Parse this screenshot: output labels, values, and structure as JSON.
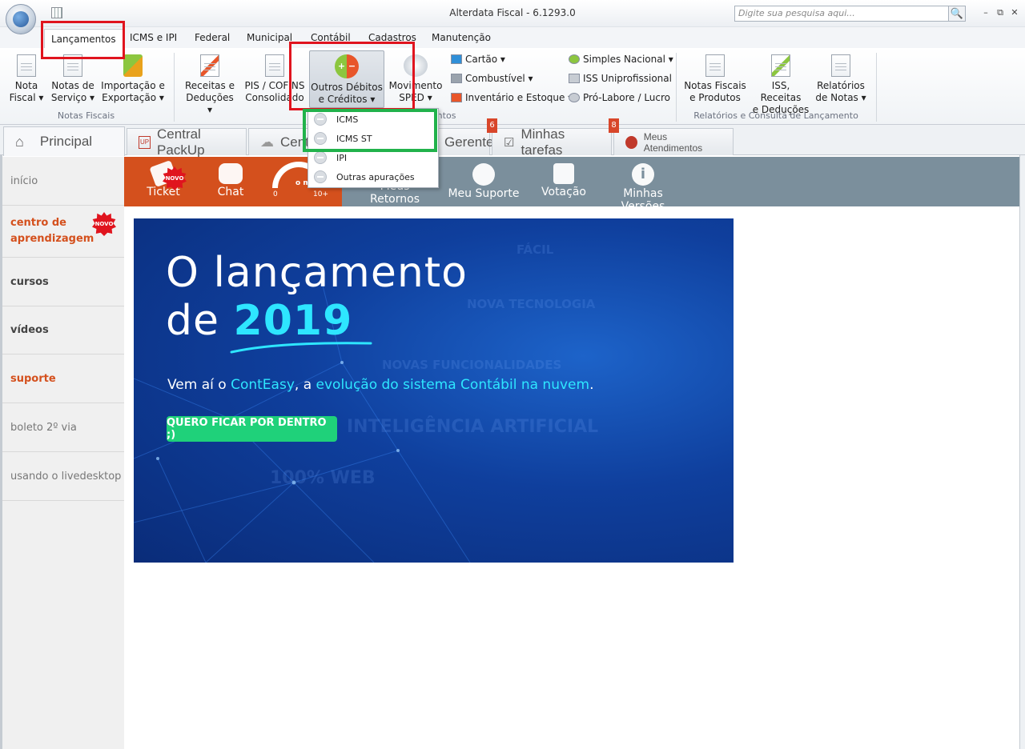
{
  "window": {
    "title": "Alterdata Fiscal - 6.1293.0",
    "search_placeholder": "Digite sua pesquisa aqui..."
  },
  "menu_tabs": [
    "Lançamentos",
    "ICMS e IPI",
    "Federal",
    "Municipal",
    "Contábil",
    "Cadastros",
    "Manutenção"
  ],
  "ribbon": {
    "nota_fiscal": [
      "Nota",
      "Fiscal ▾"
    ],
    "notas_servico": [
      "Notas de",
      "Serviço ▾"
    ],
    "importacao": [
      "Importação e",
      "Exportação ▾"
    ],
    "group_notas_fiscais": "Notas Fiscais",
    "receitas": [
      "Receitas e",
      "Deduções ▾"
    ],
    "pis_cofins": [
      "PIS / COFINS",
      "Consolidado"
    ],
    "outros_debitos": [
      "Outros Débitos",
      "e Créditos ▾"
    ],
    "movimento": [
      "Movimento",
      "SPED ▾"
    ],
    "group_lancamentos": "Lançamentos",
    "cartao": "Cartão ▾",
    "combustivel": "Combustível ▾",
    "inventario": "Inventário e Estoque ▾",
    "simples": "Simples Nacional ▾",
    "iss_uni": "ISS Uniprofissional",
    "prolabore": "Pró-Labore / Lucro",
    "notas_produtos": [
      "Notas Fiscais",
      "e Produtos"
    ],
    "iss_receitas": [
      "ISS, Receitas",
      "e Deduções"
    ],
    "relatorios": [
      "Relatórios",
      "de Notas ▾"
    ],
    "group_relatorios": "Relatórios e Consulta de Lançamento"
  },
  "dropdown": [
    "ICMS",
    "ICMS ST",
    "IPI",
    "Outras apurações"
  ],
  "tabs": {
    "principal": "Principal",
    "packup": "Central PackUp",
    "central": "Central",
    "gerente": "Gerente",
    "tarefas": "Minhas tarefas",
    "atendimentos": "Meus Atendimentos",
    "badge1": "6",
    "badge2": "8"
  },
  "sidebar": [
    "início",
    "centro de aprendizagem",
    "cursos",
    "vídeos",
    "suporte",
    "boleto 2º via",
    "usando o livedesktop"
  ],
  "novo": "NOVO",
  "toolbar": {
    "ticket": "Ticket",
    "chat": "Chat",
    "gauge_min": "0",
    "gauge_max": "10+",
    "gauge_mid": "o min",
    "retornos": "Meus Retornos",
    "suporte": "Meu Suporte",
    "votacao": "Votação",
    "versoes": "Minhas Versões"
  },
  "banner": {
    "line1": "O lançamento",
    "line2": "de ",
    "year": "2019",
    "sub_a": "Vem aí o ",
    "sub_b": "ContEasy",
    "sub_c": ", a ",
    "sub_d": "evolução do sistema Contábil na nuvem",
    "sub_e": ".",
    "cta": "QUERO FICAR POR DENTRO ;)",
    "ghost": [
      "FÁCIL",
      "NOVA TECNOLOGIA",
      "NOVAS FUNCIONALIDADES",
      "INTELIGÊNCIA ARTIFICIAL",
      "100% WEB"
    ]
  },
  "colors": {
    "accent_orange": "#d4501d",
    "toolbar_gray": "#7b8f9c",
    "highlight_red": "#e0141e",
    "highlight_green": "#21b24b",
    "banner_cyan": "#2ee6ff",
    "cta_green": "#1fd17a"
  }
}
